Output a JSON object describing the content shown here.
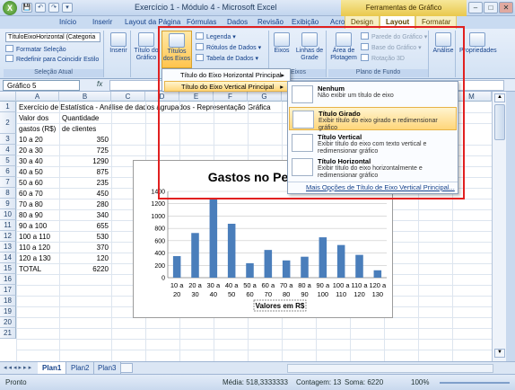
{
  "window": {
    "title": "Exercício 1 - Módulo 4 - Microsoft Excel",
    "context_header": "Ferramentas de Gráfico",
    "controls": [
      "–",
      "□",
      "✕"
    ]
  },
  "quick_access": [
    "💾",
    "↶",
    "↷",
    "▾"
  ],
  "tabs": [
    "Início",
    "Inserir",
    "Layout da Página",
    "Fórmulas",
    "Dados",
    "Revisão",
    "Exibição",
    "Acrobat",
    "Design",
    "Layout",
    "Formatar"
  ],
  "ribbon": {
    "selection": {
      "dropdown": "TítuloEixoHorizontal (Categoria",
      "format": "Formatar Seleção",
      "reset": "Redefinir para Coincidir Estilo",
      "label": "Seleção Atual"
    },
    "insert": "Inserir",
    "chart_title": "Título do Gráfico",
    "axis_titles": "Títulos dos Eixos",
    "legend": "Legenda",
    "data_labels": "Rótulos de Dados",
    "data_table": "Tabela de Dados",
    "axes": "Eixos",
    "gridlines": "Linhas de Grade",
    "axes_label": "Eixos",
    "plot_area": "Área de Plotagem",
    "chart_wall": "Parede do Gráfico",
    "chart_floor": "Base do Gráfico",
    "rotation": "Rotação 3D",
    "background_label": "Plano de Fundo",
    "analysis": "Análise",
    "properties": "Propriedades"
  },
  "formula_bar": {
    "namebox": "Gráfico 5",
    "fx": "fx"
  },
  "columns": [
    "A",
    "B",
    "C",
    "D",
    "E",
    "F",
    "G",
    "H",
    "I",
    "J",
    "K",
    "L",
    "M"
  ],
  "rows": [
    "1",
    "2",
    "3",
    "4",
    "5",
    "6",
    "7",
    "8",
    "9",
    "10",
    "11",
    "12",
    "13",
    "14",
    "15",
    "16",
    "17",
    "18",
    "19",
    "20",
    "21"
  ],
  "sheet": {
    "a1": "Exercício de Estatística - Análise de dados agrupados - Representação Gráfica",
    "a2": "Valor dos",
    "b2": "Quantidade",
    "a3_cont": "gastos (R$)",
    "b3_cont": "de clientes",
    "table": [
      [
        "10 a 20",
        "350"
      ],
      [
        "20 a 30",
        "725"
      ],
      [
        "30 a 40",
        "1290"
      ],
      [
        "40 a 50",
        "875"
      ],
      [
        "50 a 60",
        "235"
      ],
      [
        "60 a 70",
        "450"
      ],
      [
        "70 a 80",
        "280"
      ],
      [
        "80 a 90",
        "340"
      ],
      [
        "90 a 100",
        "655"
      ],
      [
        "100 a 110",
        "530"
      ],
      [
        "110 a 120",
        "370"
      ],
      [
        "120 a 130",
        "120"
      ],
      [
        "TOTAL",
        "6220"
      ]
    ]
  },
  "menu": {
    "horizontal": "Título do Eixo Horizontal Principal",
    "vertical": "Título do Eixo Vertical Principal",
    "options": [
      {
        "title": "Nenhum",
        "desc": "Não exibir um título de eixo"
      },
      {
        "title": "Título Girado",
        "desc": "Exibir título do eixo girado e redimensionar gráfico"
      },
      {
        "title": "Título Vertical",
        "desc": "Exibir título do eixo com texto vertical e redimensionar gráfico"
      },
      {
        "title": "Título Horizontal",
        "desc": "Exibir título do eixo horizontalmente e redimensionar gráfico"
      }
    ],
    "more": "Mais Opções de Título de Eixo Vertical Principal..."
  },
  "sheet_tabs": [
    "Plan1",
    "Plan2",
    "Plan3"
  ],
  "status": {
    "mode": "Pronto",
    "avg": "Média: 518,3333333",
    "count": "Contagem: 13",
    "sum": "Soma: 6220",
    "zoom": "100%"
  },
  "chart_data": {
    "type": "bar",
    "title": "Gastos no Período",
    "xlabel": "Valores em R$",
    "categories": [
      "10 a 20",
      "20 a 30",
      "30 a 40",
      "40 a 50",
      "50 a 60",
      "60 a 70",
      "70 a 80",
      "80 a 90",
      "90 a 100",
      "100 a 110",
      "110 a 120",
      "120 a 130"
    ],
    "values": [
      350,
      725,
      1290,
      875,
      235,
      450,
      280,
      340,
      655,
      530,
      370,
      120
    ],
    "ylim": [
      0,
      1400
    ],
    "yticks": [
      "0",
      "200",
      "400",
      "600",
      "800",
      "1000",
      "1200",
      "1400"
    ],
    "grid": true,
    "bar_color": "#4a7ebb"
  }
}
